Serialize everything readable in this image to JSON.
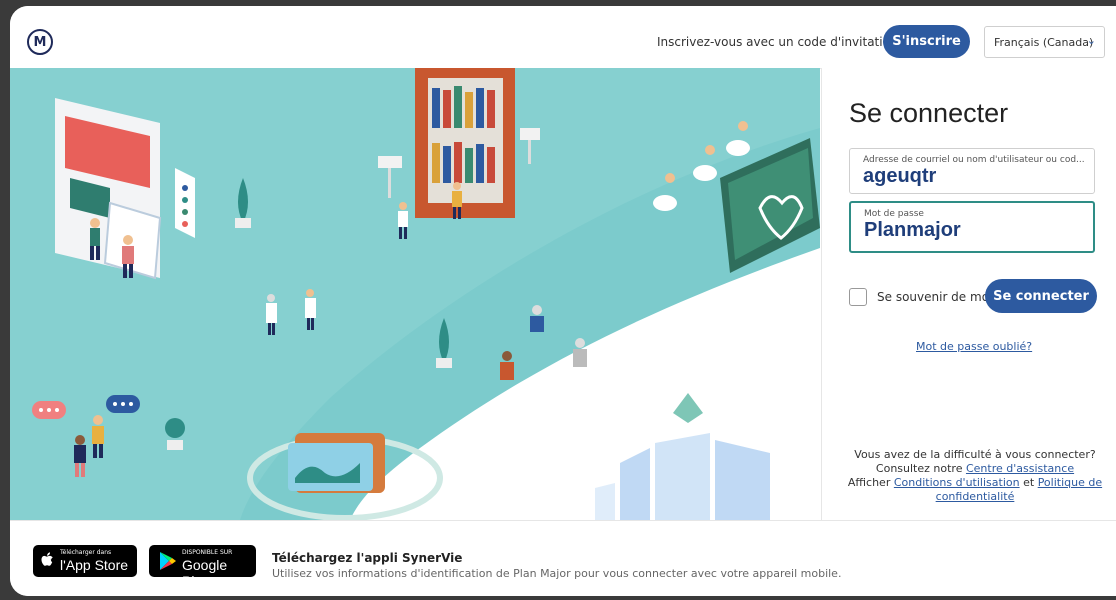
{
  "header": {
    "logo_letter": "M",
    "invite_text": "Inscrivez-vous avec un code d'invitation",
    "signup_label": "S'inscrire",
    "language": "Français (Canada)"
  },
  "login": {
    "title": "Se connecter",
    "username_label": "Adresse de courriel ou nom d'utilisateur ou cod...",
    "username_value": "ageuqtr",
    "password_label": "Mot de passe",
    "password_value": "Planmajor",
    "remember_label": "Se souvenir de moi",
    "submit_label": "Se connecter",
    "forgot_link": "Mot de passe oublié?"
  },
  "help": {
    "line1": "Vous avez de la difficulté à vous connecter?",
    "line2_prefix": "Consultez notre",
    "assistance_link": "Centre d'assistance",
    "line3_prefix": "Afficher",
    "terms_link": "Conditions d'utilisation",
    "and": "et",
    "privacy_link": "Politique de confidentialité"
  },
  "footer": {
    "appstore_small": "Télécharger dans",
    "appstore_big": "l'App Store",
    "googleplay_small": "DISPONIBLE SUR",
    "googleplay_big": "Google Play",
    "title": "Téléchargez l'appli SynerVie",
    "subtitle": "Utilisez vos informations d'identification de Plan Major pour vous connecter avec votre appareil mobile."
  },
  "colors": {
    "primary": "#2d5aa0",
    "teal": "#7ccbcc",
    "focus_border": "#2e8d86"
  }
}
